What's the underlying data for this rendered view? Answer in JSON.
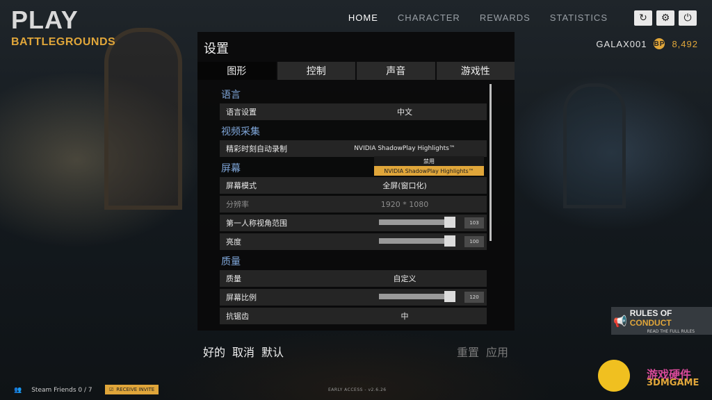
{
  "logo": {
    "play": "PLAY",
    "battlegrounds": "BATTLEGROUNDS"
  },
  "nav": {
    "items": [
      "HOME",
      "CHARACTER",
      "REWARDS",
      "STATISTICS"
    ],
    "active": "HOME"
  },
  "top_buttons": {
    "restart_icon": "↻",
    "gear_icon": "⚙",
    "power_icon": "⏻"
  },
  "user": {
    "name": "GALAX001",
    "coin_icon": "BP",
    "points": "8,492"
  },
  "settings": {
    "title": "设置",
    "tabs": [
      "图形",
      "控制",
      "声音",
      "游戏性"
    ],
    "sections": {
      "language": "语言",
      "video_capture": "视频采集",
      "screen": "屏幕",
      "quality": "质量"
    },
    "rows": {
      "language_setting": {
        "label": "语言设置",
        "value": "中文"
      },
      "highlights": {
        "label": "精彩时刻自动录制",
        "value": "NVIDIA ShadowPlay Highlights™"
      },
      "screen_mode": {
        "label": "屏幕模式",
        "value": "全屏(窗口化)"
      },
      "resolution": {
        "label": "分辨率",
        "value": "1920 * 1080"
      },
      "fov": {
        "label": "第一人称视角范围",
        "value": "103",
        "level": 0.93
      },
      "brightness": {
        "label": "亮度",
        "value": "100",
        "level": 0.93
      },
      "quality": {
        "label": "质量",
        "value": "自定义"
      },
      "screen_scale": {
        "label": "屏幕比例",
        "value": "120",
        "level": 0.93
      },
      "antialiasing": {
        "label": "抗锯齿",
        "value": "中"
      }
    },
    "dropdown": {
      "options": [
        "禁用",
        "NVIDIA ShadowPlay Highlights™"
      ],
      "selected": "NVIDIA ShadowPlay Highlights™"
    },
    "footer": {
      "ok": "好的",
      "cancel": "取消",
      "default": "默认",
      "reset": "重置",
      "apply": "应用"
    }
  },
  "bottom": {
    "friends": "Steam Friends 0 / 7",
    "receive_invite": "RECEIVE INVITE",
    "version": "EARLY ACCESS - v2.6.26"
  },
  "rules": {
    "rules_of": "RULES OF",
    "conduct": "CONDUCT",
    "read": "READ THE FULL RULES"
  },
  "watermark": {
    "line1": "游戏硬件",
    "line2": "3DMGAME"
  },
  "colors": {
    "accent": "#e0a63a",
    "section": "#7fa6d9"
  }
}
